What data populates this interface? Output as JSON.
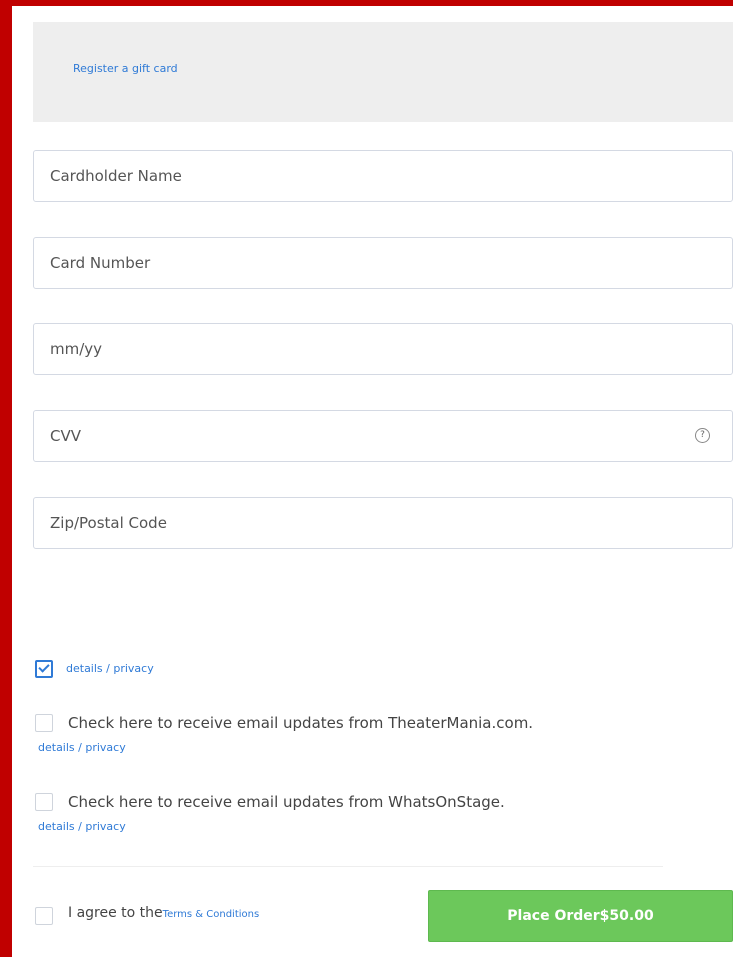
{
  "gift_card": {
    "link_label": "Register a gift card"
  },
  "fields": {
    "cardholder_name": {
      "placeholder": "Cardholder Name",
      "value": ""
    },
    "card_number": {
      "placeholder": "Card Number",
      "value": ""
    },
    "expiry": {
      "placeholder": "mm/yy",
      "value": ""
    },
    "cvv": {
      "placeholder": "CVV",
      "value": "",
      "help_icon": "?"
    },
    "zip": {
      "placeholder": "Zip/Postal Code",
      "value": ""
    }
  },
  "consents": {
    "first": {
      "checked": true,
      "link_label": "details / privacy"
    },
    "theatermania": {
      "checked": false,
      "label": "Check here to receive email updates from TheaterMania.com.",
      "link_label": "details / privacy"
    },
    "whatsonstage": {
      "checked": false,
      "label": "Check here to receive email updates from WhatsOnStage.",
      "link_label": "details / privacy"
    }
  },
  "terms": {
    "checked": false,
    "prefix": "I agree to the",
    "link_label": "Terms & Conditions"
  },
  "order": {
    "button_label": "Place Order$50.00"
  },
  "colors": {
    "frame": "#c00000",
    "link": "#2f7ad6",
    "button": "#6cc85b",
    "panel": "#eeeeee"
  }
}
